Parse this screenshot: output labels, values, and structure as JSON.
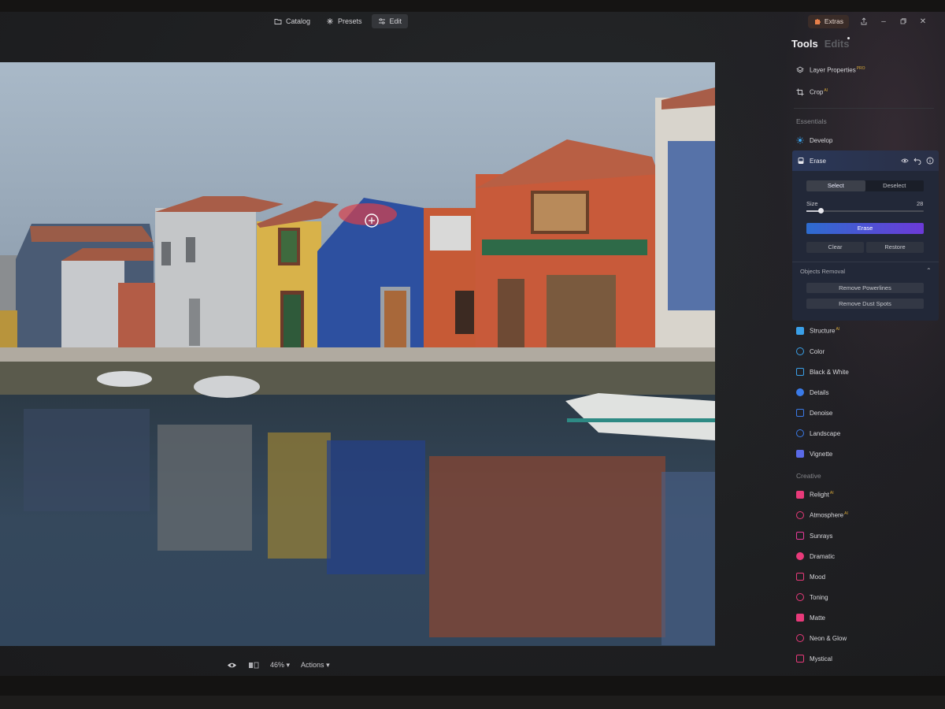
{
  "nav": {
    "tabs": [
      {
        "label": "Catalog",
        "icon": "folder-icon"
      },
      {
        "label": "Presets",
        "icon": "sparkle-icon"
      },
      {
        "label": "Edit",
        "icon": "sliders-icon"
      }
    ],
    "active": "Edit"
  },
  "window": {
    "extras_label": "Extras",
    "extras_icon": "puzzle-icon",
    "share_icon": "share-icon",
    "minimize_icon": "minimize-icon",
    "restore_icon": "restore-icon",
    "close_icon": "close-icon"
  },
  "bottombar": {
    "zoom": "46%",
    "actions_label": "Actions",
    "preview_icon": "eye-icon",
    "compare_icon": "compare-icon"
  },
  "panel": {
    "tab_tools": "Tools",
    "tab_edits": "Edits",
    "top_tools": [
      {
        "label": "Layer Properties",
        "badge": "PRO",
        "icon": "layers-icon"
      },
      {
        "label": "Crop",
        "badge": "AI",
        "icon": "crop-icon"
      }
    ],
    "essentials_title": "Essentials",
    "develop": {
      "label": "Develop",
      "icon": "sun-icon"
    },
    "erase": {
      "label": "Erase",
      "icon": "eraser-icon",
      "mode_options": [
        "Select",
        "Deselect"
      ],
      "mode_selected": "Select",
      "size_label": "Size",
      "size_value": "28",
      "size_fraction": 0.12,
      "erase_button": "Erase",
      "clear_button": "Clear",
      "restore_button": "Restore",
      "objects_removal_title": "Objects Removal",
      "remove_powerlines": "Remove Powerlines",
      "remove_dust_spots": "Remove Dust Spots"
    },
    "essentials_rest": [
      {
        "label": "Structure",
        "badge": "AI",
        "icon": "structure-icon",
        "color": "#3aa0e8"
      },
      {
        "label": "Color",
        "badge": "",
        "icon": "color-circles-icon",
        "color": "#3aa0e8"
      },
      {
        "label": "Black & White",
        "badge": "",
        "icon": "black-white-icon",
        "color": "#3aa0e8"
      },
      {
        "label": "Details",
        "badge": "",
        "icon": "details-grid-icon",
        "color": "#3a7ae8"
      },
      {
        "label": "Denoise",
        "badge": "",
        "icon": "denoise-icon",
        "color": "#3a7ae8"
      },
      {
        "label": "Landscape",
        "badge": "",
        "icon": "landscape-icon",
        "color": "#3a7ae8"
      },
      {
        "label": "Vignette",
        "badge": "",
        "icon": "vignette-icon",
        "color": "#5a6ae8"
      }
    ],
    "creative_title": "Creative",
    "creative": [
      {
        "label": "Relight",
        "badge": "AI",
        "icon": "relight-icon",
        "color": "#e83a7a"
      },
      {
        "label": "Atmosphere",
        "badge": "AI",
        "icon": "atmosphere-icon",
        "color": "#e83a7a"
      },
      {
        "label": "Sunrays",
        "badge": "",
        "icon": "sunrays-icon",
        "color": "#e83a9a"
      },
      {
        "label": "Dramatic",
        "badge": "",
        "icon": "dramatic-icon",
        "color": "#e83a7a"
      },
      {
        "label": "Mood",
        "badge": "",
        "icon": "mood-icon",
        "color": "#e83a7a"
      },
      {
        "label": "Toning",
        "badge": "",
        "icon": "toning-icon",
        "color": "#e83a7a"
      },
      {
        "label": "Matte",
        "badge": "",
        "icon": "matte-icon",
        "color": "#e83a7a"
      },
      {
        "label": "Neon & Glow",
        "badge": "",
        "icon": "neon-glow-icon",
        "color": "#e83a7a"
      },
      {
        "label": "Mystical",
        "badge": "",
        "icon": "mystical-icon",
        "color": "#e83a7a"
      }
    ]
  },
  "colors": {
    "accent_gradient_start": "#2d6ccf",
    "accent_gradient_end": "#6c3ad8",
    "badge_color": "#d8a93a",
    "erase_mask": "#d8404a"
  }
}
